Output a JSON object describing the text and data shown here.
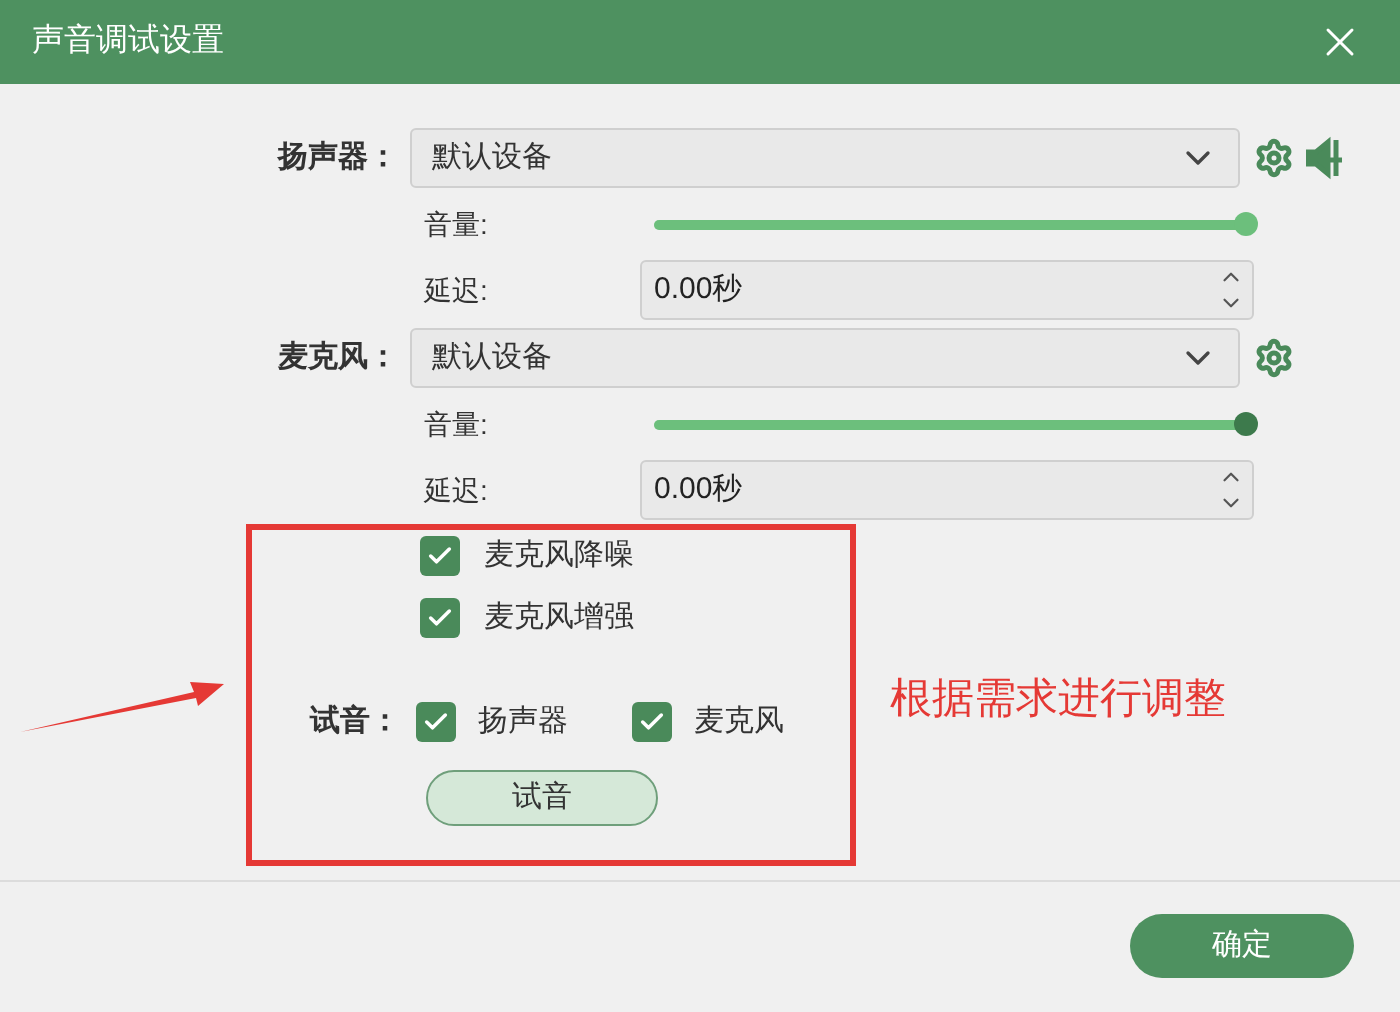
{
  "window": {
    "title": "声音调试设置"
  },
  "devices": [
    {
      "kind": "speaker",
      "label": "扬声器：",
      "device": "默认设备",
      "volume_label": "音量:",
      "volume": {
        "level": 1,
        "focused": false
      },
      "delay_label": "延迟:",
      "delay": "0.00秒"
    },
    {
      "kind": "microphone",
      "label": "麦克风：",
      "device": "默认设备",
      "volume_label": "音量:",
      "volume": {
        "level": 1,
        "focused": true
      },
      "delay_label": "延迟:",
      "delay": "0.00秒"
    }
  ],
  "options": [
    {
      "label": "麦克风降噪",
      "checked": true
    },
    {
      "label": "麦克风增强",
      "checked": true
    }
  ],
  "test": {
    "label": "试音：",
    "targets": [
      {
        "label": "扬声器",
        "checked": true
      },
      {
        "label": "麦克风",
        "checked": true
      }
    ],
    "button": "试音"
  },
  "annotation": {
    "text": "根据需求进行调整"
  },
  "ok_button": "确定"
}
